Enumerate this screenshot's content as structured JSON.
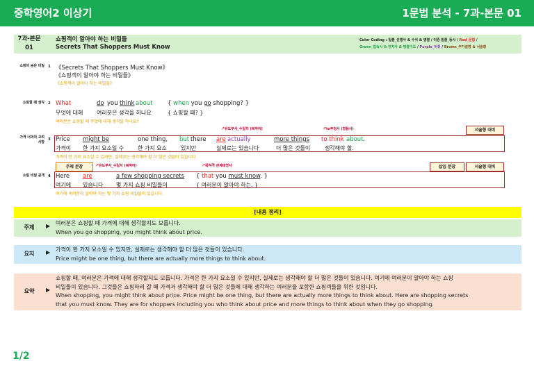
{
  "header": {
    "left": "중학영어2 이상기",
    "right": "1문법 분석 - 7과-본문 01"
  },
  "title": {
    "lesson_line1": "7과-본문",
    "lesson_line2": "01",
    "kor": "쇼핑객이 알아야 하는 비밀들",
    "eng": "Secrets That Shoppers Must Know"
  },
  "legend": {
    "line1_a": "Color Coding : 일출_선행사 & 수식 & 병렬 / 이중 밑줄_동사 / ",
    "line1_red": "Red_문법",
    "line1_b": " /",
    "line2_green": "Green_접속사 & 전치사 & 병렬구조",
    "line2_sep1": " / ",
    "line2_purple": "Purple_어휘",
    "line2_sep2": " / ",
    "line2_brown": "Brown_추가설명 & 서술형"
  },
  "s1": {
    "label": "쇼핑의 숨은 비밀",
    "num": "1",
    "eng": "《Secrets That Shoppers Must Know》",
    "kor": "《쇼핑객이 알아야 하는 비밀들》",
    "trans": "《쇼핑객이 알아야 하는 비밀들》"
  },
  "s2": {
    "label": "쇼핑할 때 생각",
    "num": "2",
    "e1": "What",
    "e2": "do",
    "e3": "you",
    "e4": "think",
    "e5": "about",
    "e6": "{ ",
    "e7": "when",
    "e8": " you ",
    "e9": "go",
    "e10": " shopping? }",
    "k1": "무엇에 대해",
    "k2": "여러분은 생각을 하나요",
    "k3": "{ 쇼핑할 때? }",
    "trans": "여러분은 쇼핑할 때 무엇에 대해 생각을 하나요?"
  },
  "s3": {
    "label_a": "가격 너머의 고려",
    "label_b": "사항",
    "num": "3",
    "note1": "유도부사_수일치 (복작어)",
    "note2": "to부정사 (형용사)",
    "tag": "서술형 대비",
    "e1": "Price",
    "e2": "might be",
    "e3": "one thing,",
    "e4": "but",
    "e5": "there",
    "e6": "are",
    "e7": "actually",
    "e8": "more things",
    "e9": "to think",
    "e10": "about",
    "e11": ".",
    "k1": "가격이",
    "k2": "한 가지 요소일 수",
    "k3": "한 가지 요소",
    "k4": "있지만",
    "k5": "실제로는 있습니다",
    "k6": "더 많은 것들이",
    "k7": "생각해야 할.",
    "trans": "가격이 한 가지 요소일 수 있지만, 실제로는 생각해야 할 더 많은 것들이 있습니다."
  },
  "s4": {
    "label": "쇼핑 비밀 공개",
    "num": "4",
    "tag_main": "주제 문장",
    "note1": "유도부사_수일치 (복작어)",
    "note2": "목적격 관계대명사",
    "tag_insert": "삽입 문장",
    "tag_essay": "서술형 대비",
    "e1": "Here",
    "e2": "are",
    "e3": "a few shopping secrets",
    "e4": "{ ",
    "e5": "that",
    "e6": " you ",
    "e7": "must know",
    "e8": ". }",
    "k1": "여기에",
    "k2": "있습니다",
    "k3": "몇 가지 쇼핑 비밀들이",
    "k4": "{ 여러분이 알아야 하는. }",
    "trans": "여기에 여러분이 알아야 하는 몇 가지 쇼핑 비밀들이 있습니다."
  },
  "summary": {
    "heading": "[내용 정리]",
    "topic": {
      "label": "주제",
      "kor": "여러분은 쇼핑할 때 가격에 대해 생각할지도 모릅니다.",
      "eng": "When you go shopping, you might think about price."
    },
    "gist": {
      "label": "요지",
      "kor": "가격이 한 가지 요소일 수 있지만, 실제로는 생각해야 할 더 많은 것들이 있습니다.",
      "eng": "Price might be one thing, but there are actually more things to think about."
    },
    "abstract": {
      "label": "요약",
      "kor1": "쇼핑할 때, 여러분은 가격에 대해 생각할지도 모릅니다. 가격은 한 가지 요소일 수 있지만, 실제로는 생각해야 할 더 많은 것들이 있습니다. 여기에 여러분이 알아야 하는 쇼핑",
      "kor2": "비밀들이 있습니다. 그것들은 쇼핑하러 갈 때 가격과 생각해야 할 더 많은 것들에 대해 생각하는 여러분을 포함한 쇼핑객들을 위한 것입니다.",
      "eng1": "When shopping, you might think about price. Price might be one thing, but there are actually more things to think about. Here are shopping secrets",
      "eng2": "that you must know. They are for shoppers including you who think about price and more things to think about when they go shopping."
    },
    "arrow": "▶"
  },
  "page": "1/2",
  "colors": {
    "header_green": "#1aab55",
    "grammar_red": "#e22222",
    "conj_green": "#1aa34a",
    "vocab_purple": "#8a3ab9",
    "note_brown": "#8b4513"
  }
}
